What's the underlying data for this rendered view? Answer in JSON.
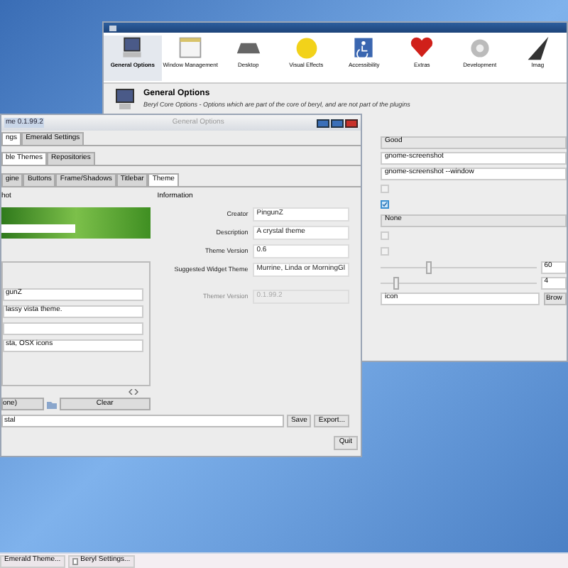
{
  "settings_window": {
    "categories": [
      {
        "label": "General Options",
        "selected": true
      },
      {
        "label": "Window Management",
        "selected": false
      },
      {
        "label": "Desktop",
        "selected": false
      },
      {
        "label": "Visual Effects",
        "selected": false
      },
      {
        "label": "Accessibility",
        "selected": false
      },
      {
        "label": "Extras",
        "selected": false
      },
      {
        "label": "Development",
        "selected": false
      },
      {
        "label": "Imag",
        "selected": false
      }
    ],
    "header": {
      "title": "General Options",
      "subtitle": "Beryl Core Options - Options which are part of the core of beryl, and are not part of the plugins"
    },
    "options": [
      {
        "kind": "combo",
        "value": "Good"
      },
      {
        "kind": "text",
        "value": "gnome-screenshot"
      },
      {
        "kind": "text",
        "value": "gnome-screenshot --window"
      },
      {
        "kind": "checkbox",
        "checked": false
      },
      {
        "kind": "checkbox",
        "checked": true
      },
      {
        "kind": "combo",
        "value": "None"
      },
      {
        "kind": "checkbox",
        "checked": false
      },
      {
        "kind": "checkbox",
        "checked": false
      },
      {
        "kind": "slider",
        "level": 0.3,
        "value": "60"
      },
      {
        "kind": "slider",
        "level": 0.08,
        "value": "4"
      },
      {
        "kind": "file",
        "value": "icon",
        "button": "Brow"
      }
    ]
  },
  "theme_window": {
    "title": "me 0.1.99.2",
    "overlay_title": "General Options",
    "top_tabs": [
      {
        "label": "ngs",
        "selected": true
      },
      {
        "label": "Emerald Settings",
        "selected": false
      }
    ],
    "sub_tabs": [
      {
        "label": "ble Themes",
        "selected": true
      },
      {
        "label": "Repositories",
        "selected": false
      }
    ],
    "section_tabs": [
      {
        "label": "gine",
        "selected": false
      },
      {
        "label": "Buttons",
        "selected": false
      },
      {
        "label": "Frame/Shadows",
        "selected": false
      },
      {
        "label": "Titlebar",
        "selected": false
      },
      {
        "label": "Theme",
        "selected": true
      }
    ],
    "screenshot_label": "hot",
    "left_fields": [
      {
        "kind": "text",
        "value": "gunZ"
      },
      {
        "kind": "text",
        "value": "lassy vista theme."
      },
      {
        "kind": "blank"
      },
      {
        "kind": "text",
        "value": "sta, OSX icons"
      }
    ],
    "left_buttons": [
      "one)",
      "Clear"
    ],
    "information": {
      "title": "Information",
      "rows": [
        {
          "label": "Creator",
          "value": "PingunZ",
          "disabled": false
        },
        {
          "label": "Description",
          "value": "A crystal theme",
          "disabled": false
        },
        {
          "label": "Theme Version",
          "value": "0.6",
          "disabled": false
        },
        {
          "label": "Suggested Widget Theme",
          "value": "Murrine, Linda or MorningGl",
          "disabled": false
        },
        {
          "label": "Themer Version",
          "value": "0.1.99.2",
          "disabled": true
        }
      ]
    },
    "name_field": "stal",
    "actions": [
      "Save",
      "Export..."
    ],
    "quit": "Quit"
  },
  "taskbar": [
    {
      "label": "Emerald Theme..."
    },
    {
      "label": "Beryl Settings..."
    }
  ]
}
